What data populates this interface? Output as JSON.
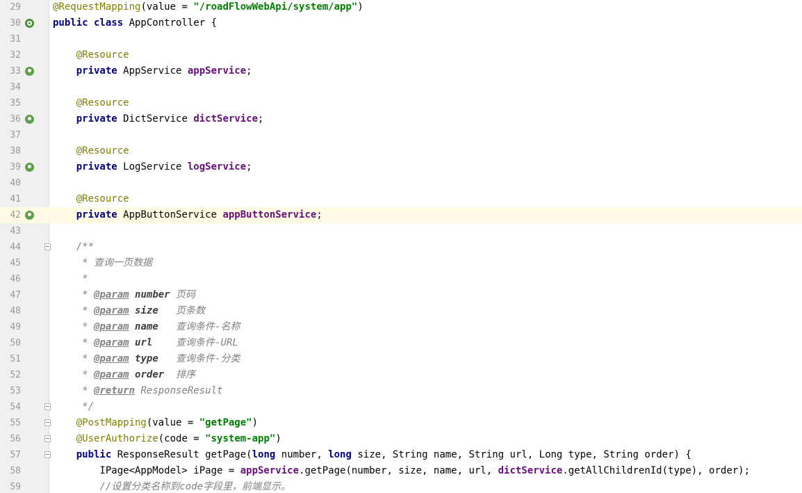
{
  "editor": {
    "language": "java",
    "current_line": 42,
    "lines": [
      {
        "n": "29",
        "tokens": [
          [
            "ann",
            "@RequestMapping"
          ],
          [
            "t",
            "(value = "
          ],
          [
            "str",
            "\"/roadFlowWebApi/system/app\""
          ],
          [
            "t",
            ")"
          ]
        ]
      },
      {
        "n": "30",
        "icon": "class",
        "tokens": [
          [
            "kw",
            "public class "
          ],
          [
            "t",
            "AppController {"
          ]
        ]
      },
      {
        "n": "31",
        "tokens": []
      },
      {
        "n": "32",
        "tokens": [
          [
            "t",
            "    "
          ],
          [
            "ann",
            "@Resource"
          ]
        ]
      },
      {
        "n": "33",
        "icon": "bean",
        "tokens": [
          [
            "t",
            "    "
          ],
          [
            "kw",
            "private "
          ],
          [
            "t",
            "AppService "
          ],
          [
            "field",
            "appService"
          ],
          [
            "t",
            ";"
          ]
        ]
      },
      {
        "n": "34",
        "tokens": []
      },
      {
        "n": "35",
        "tokens": [
          [
            "t",
            "    "
          ],
          [
            "ann",
            "@Resource"
          ]
        ]
      },
      {
        "n": "36",
        "icon": "bean",
        "tokens": [
          [
            "t",
            "    "
          ],
          [
            "kw",
            "private "
          ],
          [
            "t",
            "DictService "
          ],
          [
            "field",
            "dictService"
          ],
          [
            "t",
            ";"
          ]
        ]
      },
      {
        "n": "37",
        "tokens": []
      },
      {
        "n": "38",
        "tokens": [
          [
            "t",
            "    "
          ],
          [
            "ann",
            "@Resource"
          ]
        ]
      },
      {
        "n": "39",
        "icon": "bean",
        "tokens": [
          [
            "t",
            "    "
          ],
          [
            "kw",
            "private "
          ],
          [
            "t",
            "LogService "
          ],
          [
            "field",
            "logService"
          ],
          [
            "t",
            ";"
          ]
        ]
      },
      {
        "n": "40",
        "tokens": []
      },
      {
        "n": "41",
        "tokens": [
          [
            "t",
            "    "
          ],
          [
            "ann",
            "@Resource"
          ]
        ]
      },
      {
        "n": "42",
        "icon": "bean",
        "current": true,
        "tokens": [
          [
            "t",
            "    "
          ],
          [
            "kw",
            "private "
          ],
          [
            "t",
            "AppButtonService "
          ],
          [
            "field",
            "appButtonService"
          ],
          [
            "t",
            ";"
          ]
        ]
      },
      {
        "n": "43",
        "tokens": []
      },
      {
        "n": "44",
        "fold": true,
        "tokens": [
          [
            "t",
            "    "
          ],
          [
            "doc",
            "/**"
          ]
        ]
      },
      {
        "n": "45",
        "tokens": [
          [
            "t",
            "     "
          ],
          [
            "doc",
            "* 查询一页数据"
          ]
        ]
      },
      {
        "n": "46",
        "tokens": [
          [
            "t",
            "     "
          ],
          [
            "doc",
            "*"
          ]
        ]
      },
      {
        "n": "47",
        "tokens": [
          [
            "t",
            "     "
          ],
          [
            "doc",
            "* "
          ],
          [
            "doctag",
            "@param"
          ],
          [
            "doc",
            " "
          ],
          [
            "docparam",
            "number"
          ],
          [
            "doc",
            " 页码"
          ]
        ]
      },
      {
        "n": "48",
        "tokens": [
          [
            "t",
            "     "
          ],
          [
            "doc",
            "* "
          ],
          [
            "doctag",
            "@param"
          ],
          [
            "doc",
            " "
          ],
          [
            "docparam",
            "size"
          ],
          [
            "doc",
            "   页条数"
          ]
        ]
      },
      {
        "n": "49",
        "tokens": [
          [
            "t",
            "     "
          ],
          [
            "doc",
            "* "
          ],
          [
            "doctag",
            "@param"
          ],
          [
            "doc",
            " "
          ],
          [
            "docparam",
            "name"
          ],
          [
            "doc",
            "   查询条件-名称"
          ]
        ]
      },
      {
        "n": "50",
        "tokens": [
          [
            "t",
            "     "
          ],
          [
            "doc",
            "* "
          ],
          [
            "doctag",
            "@param"
          ],
          [
            "doc",
            " "
          ],
          [
            "docparam",
            "url"
          ],
          [
            "doc",
            "    查询条件-URL"
          ]
        ]
      },
      {
        "n": "51",
        "tokens": [
          [
            "t",
            "     "
          ],
          [
            "doc",
            "* "
          ],
          [
            "doctag",
            "@param"
          ],
          [
            "doc",
            " "
          ],
          [
            "docparam",
            "type"
          ],
          [
            "doc",
            "   查询条件-分类"
          ]
        ]
      },
      {
        "n": "52",
        "tokens": [
          [
            "t",
            "     "
          ],
          [
            "doc",
            "* "
          ],
          [
            "doctag",
            "@param"
          ],
          [
            "doc",
            " "
          ],
          [
            "docparam",
            "order"
          ],
          [
            "doc",
            "  排序"
          ]
        ]
      },
      {
        "n": "53",
        "tokens": [
          [
            "t",
            "     "
          ],
          [
            "doc",
            "* "
          ],
          [
            "doctag",
            "@return"
          ],
          [
            "doc",
            " ResponseResult"
          ]
        ]
      },
      {
        "n": "54",
        "fold": true,
        "tokens": [
          [
            "t",
            "     "
          ],
          [
            "doc",
            "*/"
          ]
        ]
      },
      {
        "n": "55",
        "fold": true,
        "tokens": [
          [
            "t",
            "    "
          ],
          [
            "ann",
            "@PostMapping"
          ],
          [
            "t",
            "(value = "
          ],
          [
            "str",
            "\"getPage\""
          ],
          [
            "t",
            ")"
          ]
        ]
      },
      {
        "n": "56",
        "fold": true,
        "tokens": [
          [
            "t",
            "    "
          ],
          [
            "ann",
            "@UserAuthorize"
          ],
          [
            "t",
            "(code = "
          ],
          [
            "str",
            "\"system-app\""
          ],
          [
            "t",
            ")"
          ]
        ]
      },
      {
        "n": "57",
        "fold": true,
        "tokens": [
          [
            "t",
            "    "
          ],
          [
            "kw",
            "public "
          ],
          [
            "t",
            "ResponseResult getPage("
          ],
          [
            "kw",
            "long "
          ],
          [
            "t",
            "number, "
          ],
          [
            "kw",
            "long "
          ],
          [
            "t",
            "size, String name, String url, Long type, String order) {"
          ]
        ]
      },
      {
        "n": "58",
        "tokens": [
          [
            "t",
            "        IPage<AppModel> iPage = "
          ],
          [
            "field",
            "appService"
          ],
          [
            "t",
            ".getPage(number, size, name, url, "
          ],
          [
            "field",
            "dictService"
          ],
          [
            "t",
            ".getAllChildrenId(type), order);"
          ]
        ]
      },
      {
        "n": "59",
        "tokens": [
          [
            "t",
            "        "
          ],
          [
            "cmt",
            "//设置分类名称到code字段里，前端显示。"
          ]
        ]
      }
    ]
  },
  "colors": {
    "keyword": "#000080",
    "annotation": "#808000",
    "string": "#008000",
    "field": "#660e7a",
    "comment": "#808080",
    "current_line": "#fffae3",
    "gutter": "#f0f0f0"
  },
  "icons": {
    "class": "spring-class-icon",
    "bean": "spring-bean-icon",
    "fold": "fold-marker-icon"
  }
}
